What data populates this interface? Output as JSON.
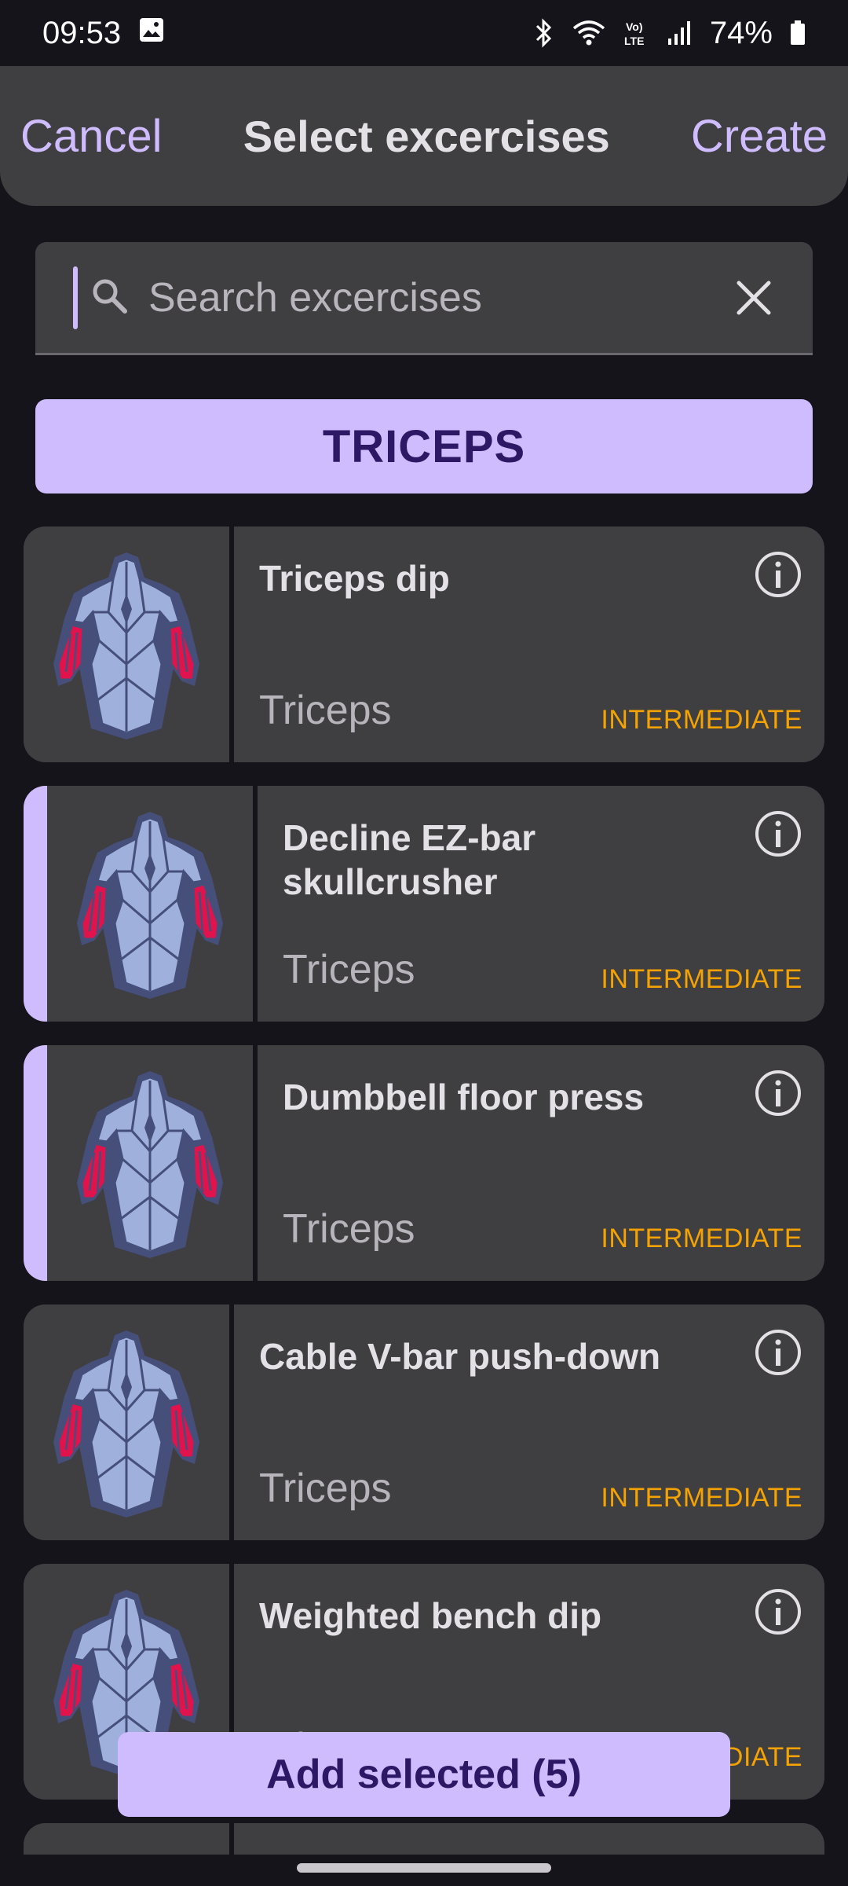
{
  "status_bar": {
    "time": "09:53",
    "battery_percent": "74%",
    "icons": [
      "gallery-icon",
      "bluetooth-icon",
      "wifi-icon",
      "volte-icon",
      "signal-icon",
      "battery-icon"
    ]
  },
  "header": {
    "cancel_label": "Cancel",
    "title": "Select excercises",
    "create_label": "Create"
  },
  "search": {
    "placeholder": "Search excercises",
    "value": ""
  },
  "category": {
    "label": "TRICEPS"
  },
  "exercises": [
    {
      "name": "Triceps dip",
      "muscle": "Triceps",
      "level": "INTERMEDIATE",
      "selected": false
    },
    {
      "name": "Decline EZ-bar skullcrusher",
      "muscle": "Triceps",
      "level": "INTERMEDIATE",
      "selected": true
    },
    {
      "name": "Dumbbell floor press",
      "muscle": "Triceps",
      "level": "INTERMEDIATE",
      "selected": true
    },
    {
      "name": "Cable V-bar push-down",
      "muscle": "Triceps",
      "level": "INTERMEDIATE",
      "selected": false
    },
    {
      "name": "Weighted bench dip",
      "muscle": "Triceps",
      "level": "INTERMEDIATE",
      "selected": false
    }
  ],
  "footer": {
    "add_selected_label": "Add selected (5)"
  },
  "colors": {
    "accent": "#cfbcff",
    "level": "#f5a300",
    "background": "#16141b",
    "surface": "#3f3e41"
  }
}
